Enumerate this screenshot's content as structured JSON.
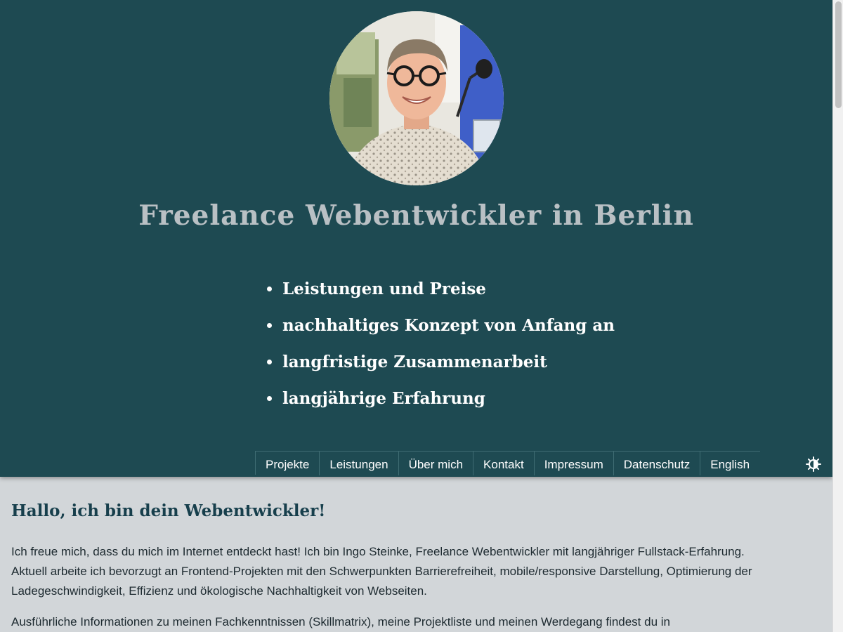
{
  "header": {
    "title": "Freelance Webentwickler in Berlin",
    "usps": [
      "Leistungen und Preise",
      "nachhaltiges Konzept von Anfang an",
      "langfristige Zusammenarbeit",
      "langjährige Erfahrung"
    ],
    "background_color": "#1e4a52"
  },
  "nav": {
    "items": [
      {
        "label": "Projekte"
      },
      {
        "label": "Leistungen"
      },
      {
        "label": "Über mich"
      },
      {
        "label": "Kontakt"
      },
      {
        "label": "Impressum"
      },
      {
        "label": "Datenschutz"
      },
      {
        "label": "English"
      }
    ],
    "theme_toggle_icon": "contrast-icon"
  },
  "main": {
    "heading": "Hallo, ich bin dein Webentwickler!",
    "paragraphs": [
      "Ich freue mich, dass du mich im Internet entdeckt hast! Ich bin Ingo Steinke, Freelance Webentwickler mit langjähriger Fullstack-Erfahrung. Aktuell arbeite ich bevorzugt an Frontend-Projekten mit den Schwerpunkten Barrierefreiheit, mobile/responsive Darstellung, Optimierung der Ladegeschwindigkeit, Effizienz und ökologische Nachhaltigkeit von Webseiten.",
      "Ausführliche Informationen zu meinen Fachkenntnissen (Skillmatrix), meine Projektliste und meinen Werdegang findest du in"
    ]
  },
  "colors": {
    "header_bg": "#1e4a52",
    "page_bg": "#d2d6d9",
    "heading": "#173f4c",
    "title_text": "#b9c0c4"
  }
}
